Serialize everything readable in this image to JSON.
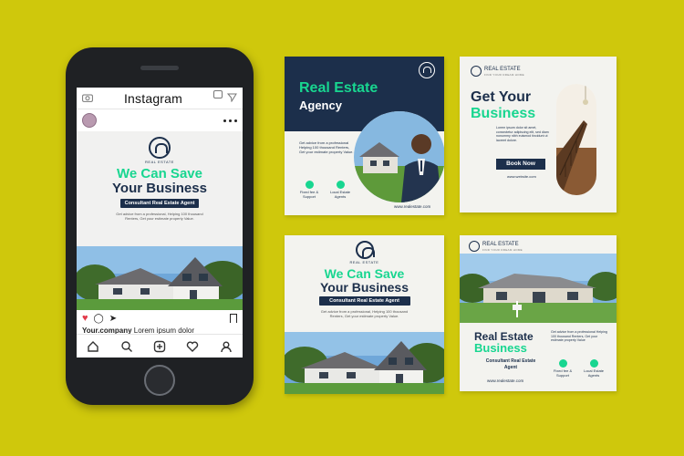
{
  "instagram": {
    "app_title": "Instagram",
    "post": {
      "logo_caption": "REAL ESTATE",
      "headline_1": "We Can Save",
      "headline_2": "Your Business",
      "pill": "Consultant Real Estate Agent",
      "body_1": "Get advice from a professional, Helping 100 thousand",
      "body_2": "Renters, Get your estimate property Value."
    },
    "caption_user": "Your.company",
    "caption_text": "Lorem ipsum dolor",
    "nav_icons": [
      "home-icon",
      "search-icon",
      "add-post-icon",
      "heart-icon",
      "profile-icon"
    ]
  },
  "card_agency": {
    "title_1": "Real Estate",
    "title_2": "Agency",
    "body": "Get advice from a professional Helping 100 thousand Renters, Get your estimate property Value.",
    "feature_1": "Fixed fee & Support",
    "feature_2": "Local Estate Agents",
    "url": "www.realestate.com"
  },
  "card_business": {
    "brand": "REAL ESTATE",
    "tagline": "FIND YOUR DREAM HOME",
    "title_1": "Get Your",
    "title_2": "Business",
    "body": "Lorem ipsum dolor sit amet, consectetur adipiscing elit, sed diam nonummy nibh euismod tincidunt ut laoreet dolore.",
    "button": "Book Now",
    "url": "www.website.com"
  },
  "card_save": {
    "logo_caption": "REAL ESTATE",
    "headline_1": "We Can Save",
    "headline_2": "Your Business",
    "pill": "Consultant Real Estate Agent",
    "body_1": "Get advice from a professional, Helping 100 thousand",
    "body_2": "Renters, Get your estimate property Value."
  },
  "card_consultant": {
    "brand": "REAL ESTATE",
    "tagline": "FIND YOUR DREAM HOME",
    "title_1": "Real Estate",
    "title_2": "Business",
    "subtitle": "Consultant Real Estate Agent",
    "url": "www.realestate.com",
    "body": "Get advice from a professional Helping 100 thousand Renters, Get your estimate property Value",
    "feature_1": "Fixed fee & Support",
    "feature_2": "Local Estate Agents"
  },
  "colors": {
    "background": "#cfc80c",
    "navy": "#1c2f4b",
    "accent_green": "#18d690",
    "phone_body": "#1f2124"
  }
}
